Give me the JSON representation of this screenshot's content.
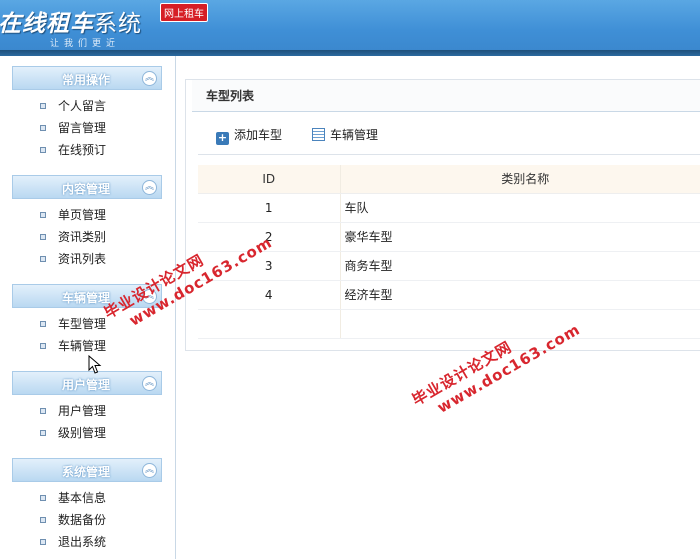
{
  "header": {
    "logo_bold": "在线租车",
    "logo_light": "系统",
    "badge": "网上租车",
    "slogan": "让我们更近"
  },
  "sidebar": {
    "groups": [
      {
        "title": "常用操作",
        "items": [
          "个人留言",
          "留言管理",
          "在线预订"
        ]
      },
      {
        "title": "内容管理",
        "items": [
          "单页管理",
          "资讯类别",
          "资讯列表"
        ]
      },
      {
        "title": "车辆管理",
        "items": [
          "车型管理",
          "车辆管理"
        ]
      },
      {
        "title": "用户管理",
        "items": [
          "用户管理",
          "级别管理"
        ]
      },
      {
        "title": "系统管理",
        "items": [
          "基本信息",
          "数据备份",
          "退出系统"
        ]
      }
    ],
    "collapse_glyph": "︽"
  },
  "main": {
    "panel_title": "车型列表",
    "toolbar": {
      "add_label": "添加车型",
      "manage_label": "车辆管理"
    },
    "table": {
      "headers": [
        "ID",
        "类别名称"
      ],
      "rows": [
        {
          "id": "1",
          "name": "车队"
        },
        {
          "id": "2",
          "name": "豪华车型"
        },
        {
          "id": "3",
          "name": "商务车型"
        },
        {
          "id": "4",
          "name": "经济车型"
        }
      ]
    }
  },
  "watermarks": [
    {
      "line1": "毕业设计论文网",
      "line2": "www.doc163.com"
    },
    {
      "line1": "毕业设计论文网",
      "line2": "www.doc163.com"
    }
  ],
  "colors": {
    "header": "#3f8fd6",
    "watermark": "#d8262e",
    "badge": "#d61e25"
  }
}
